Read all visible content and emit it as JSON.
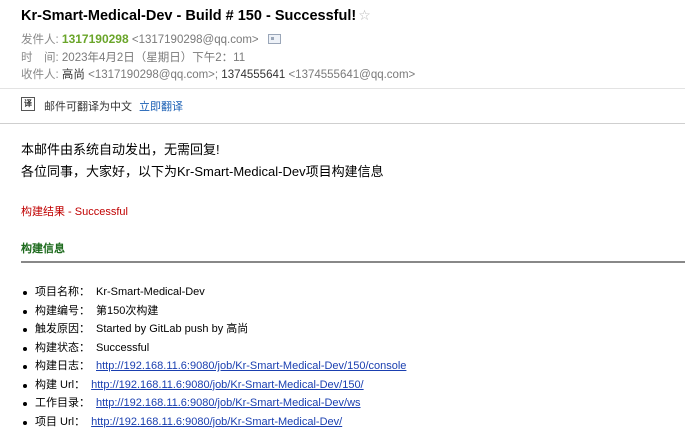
{
  "email": {
    "subject": "Kr-Smart-Medical-Dev - Build # 150 - Successful!",
    "star_icon": "star-icon",
    "from": {
      "label": "发件人:",
      "name": "1317190298",
      "address": "<1317190298@qq.com>",
      "card_icon": "contact-card-icon"
    },
    "time": {
      "label": "时　间:",
      "value": "2023年4月2日（星期日）下午2：11"
    },
    "to": {
      "label": "收件人:",
      "recipient1_name": "高尚",
      "recipient1_address": "<1317190298@qq.com>;",
      "recipient2_name": "1374555641",
      "recipient2_address": "<1374555641@qq.com>"
    }
  },
  "translate_bar": {
    "icon": "translate-icon",
    "text": "邮件可翻译为中文",
    "link": "立即翻译"
  },
  "body": {
    "line1": "本邮件由系统自动发出，无需回复!",
    "line2": "各位同事，大家好，以下为Kr-Smart-Medical-Dev项目构建信息",
    "result": "构建结果 - Successful",
    "section_title": "构建信息",
    "items": [
      {
        "label": "项目名称：",
        "value": "Kr-Smart-Medical-Dev",
        "is_link": false
      },
      {
        "label": "构建编号：",
        "value": "第150次构建",
        "is_link": false
      },
      {
        "label": "触发原因：",
        "value": "Started by GitLab push by 高尚",
        "is_link": false
      },
      {
        "label": "构建状态：",
        "value": "Successful",
        "is_link": false
      },
      {
        "label": "构建日志：",
        "value": "http://192.168.11.6:9080/job/Kr-Smart-Medical-Dev/150/console",
        "is_link": true
      },
      {
        "label": "构建 Url：",
        "value": "http://192.168.11.6:9080/job/Kr-Smart-Medical-Dev/150/",
        "is_link": true
      },
      {
        "label": "工作目录：",
        "value": "http://192.168.11.6:9080/job/Kr-Smart-Medical-Dev/ws",
        "is_link": true
      },
      {
        "label": "项目 Url：",
        "value": "http://192.168.11.6:9080/job/Kr-Smart-Medical-Dev/",
        "is_link": true
      }
    ]
  }
}
